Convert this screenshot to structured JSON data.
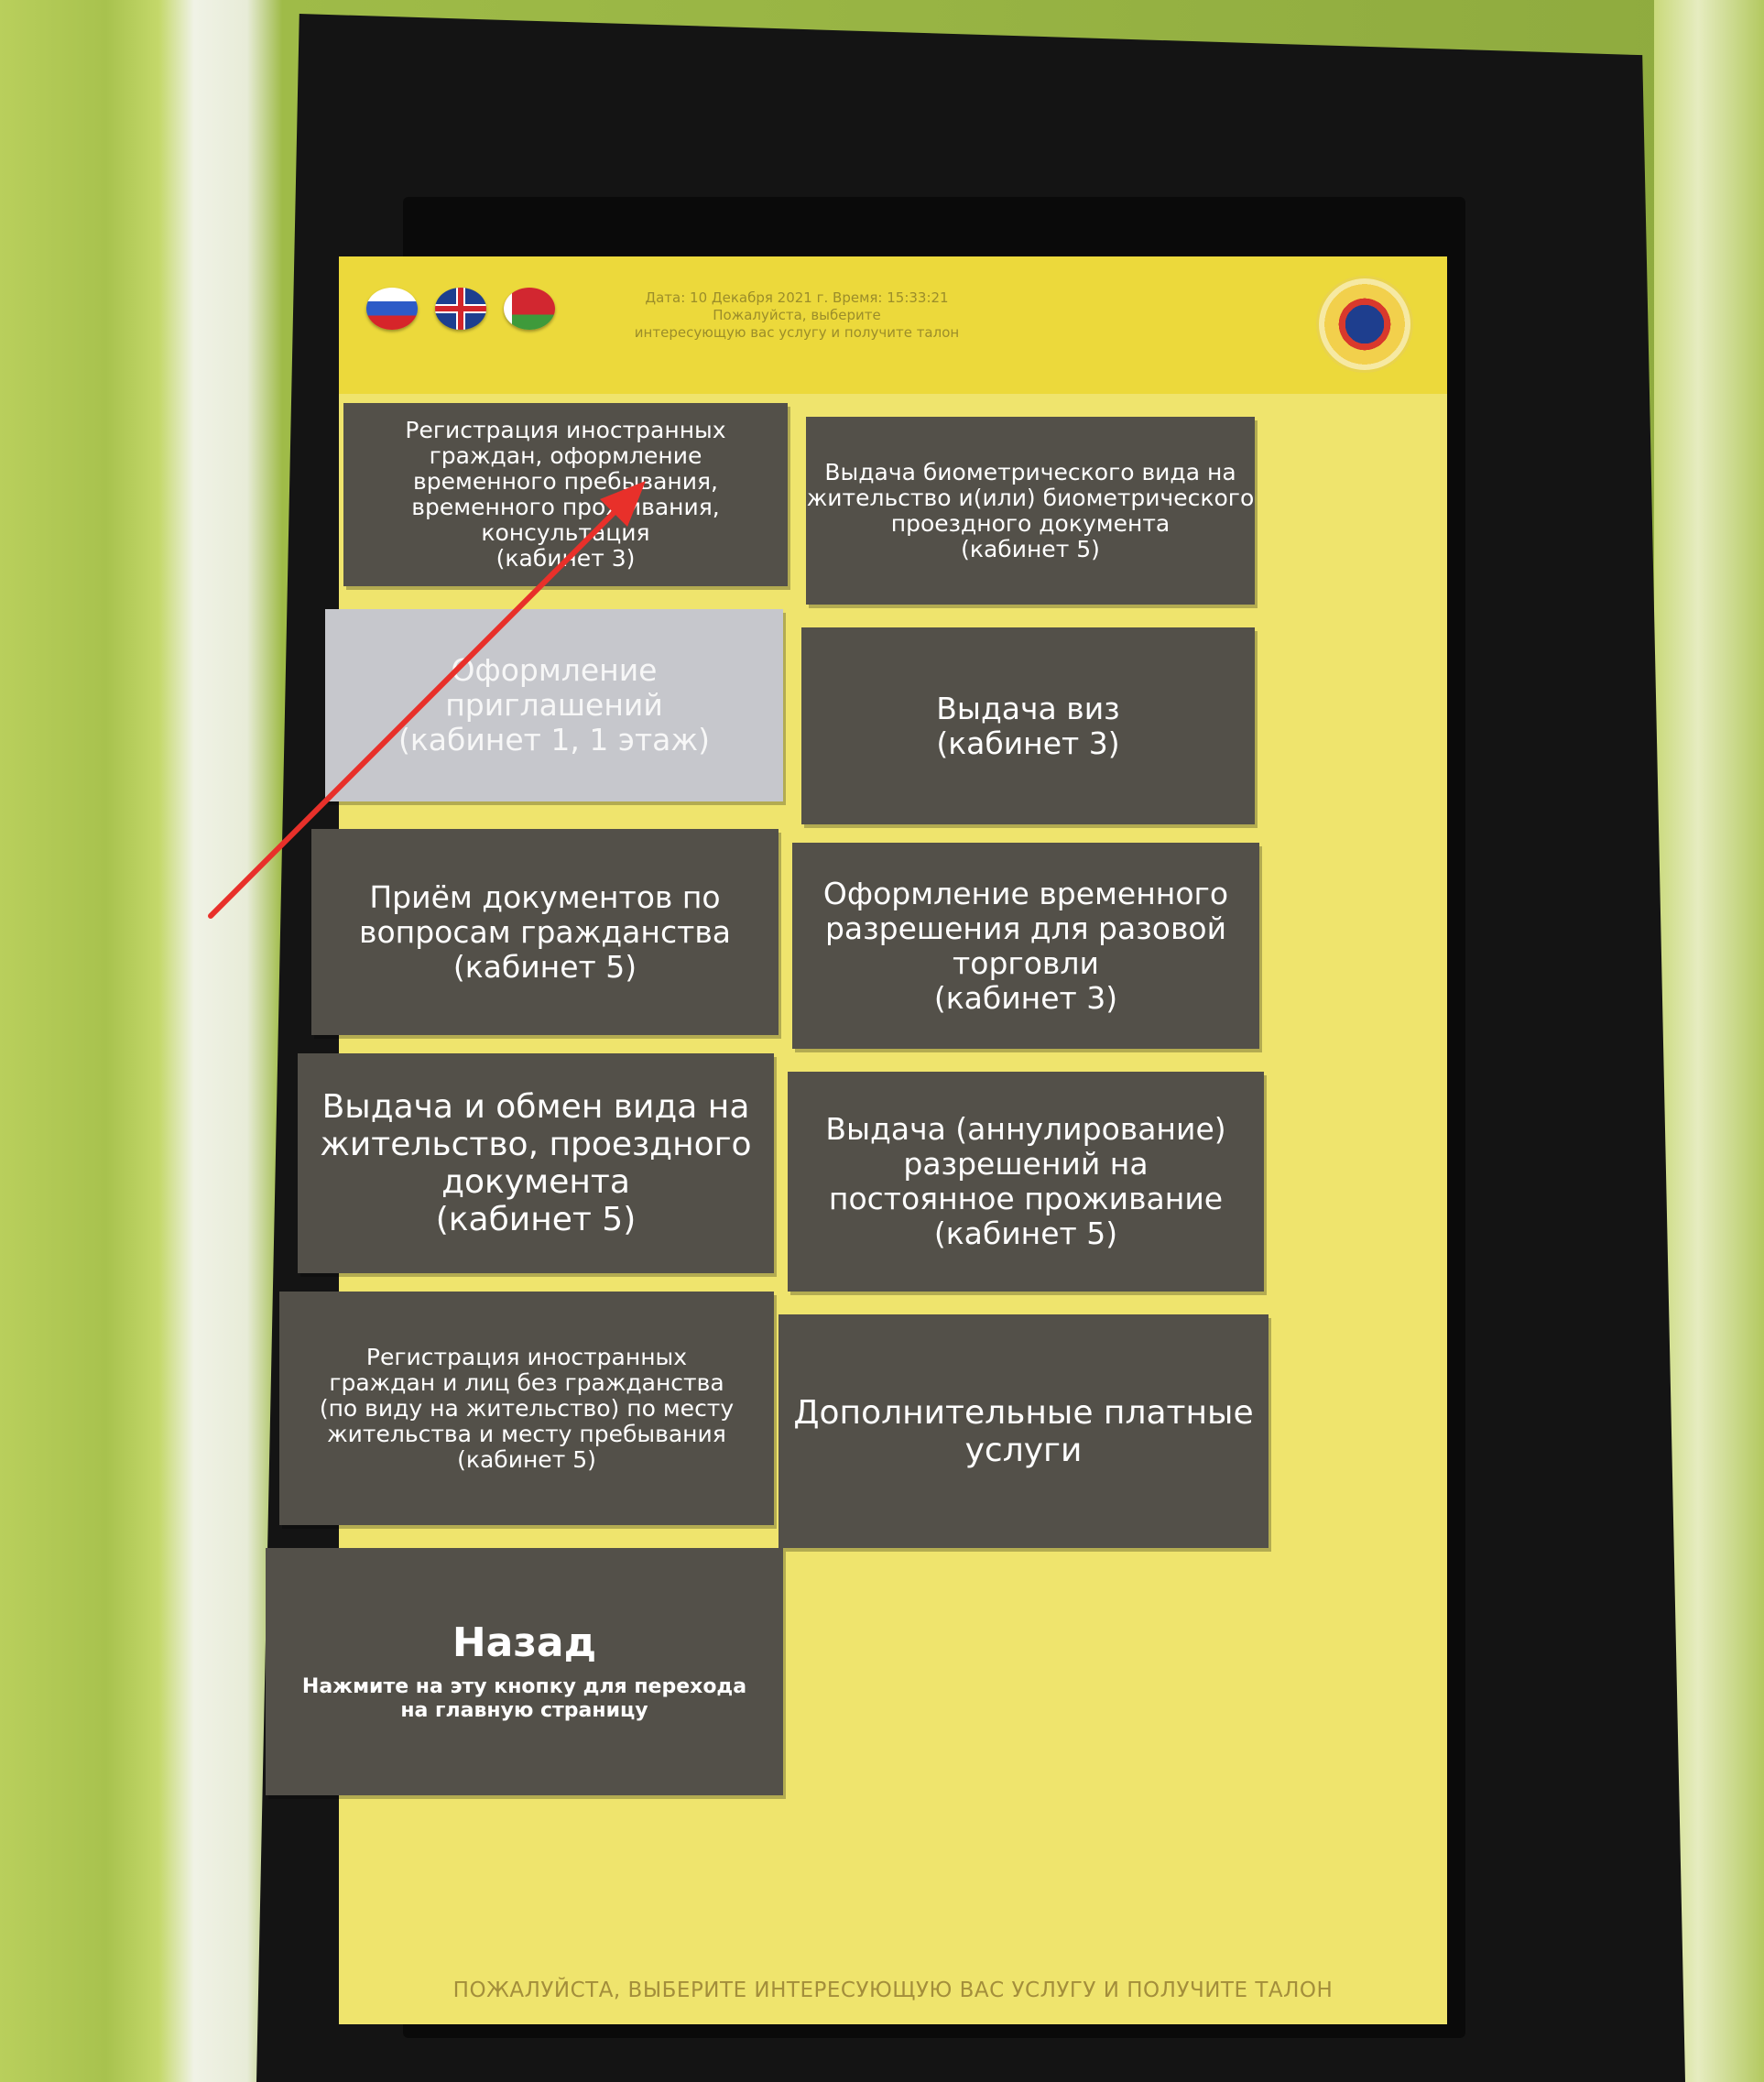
{
  "header": {
    "date_line": "Дата: 10 Декабря 2021 г.   Время: 15:33:21",
    "prompt_line1": "Пожалуйста, выберите",
    "prompt_line2": "интересующую вас услугу и получите талон"
  },
  "languages": [
    {
      "name": "ru-flag-icon"
    },
    {
      "name": "uk-flag-icon"
    },
    {
      "name": "by-flag-icon"
    }
  ],
  "buttons": {
    "b1": [
      "Регистрация иностранных",
      "граждан, оформление",
      "временного пребывания,",
      "временного проживания,",
      "консультация",
      "(кабинет 3)"
    ],
    "b2": [
      "Выдача биометрического вида на",
      "жительство и(или) биометрического",
      "проездного документа",
      "(кабинет 5)"
    ],
    "b3": [
      "Оформление",
      "приглашений",
      "(кабинет 1, 1 этаж)"
    ],
    "b4": [
      "Выдача виз",
      "(кабинет 3)"
    ],
    "b5": [
      "Приём документов по",
      "вопросам гражданства",
      "(кабинет 5)"
    ],
    "b6": [
      "Оформление временного",
      "разрешения для разовой",
      "торговли",
      "(кабинет 3)"
    ],
    "b7": [
      "Выдача и обмен вида на",
      "жительство, проездного",
      "документа",
      "(кабинет 5)"
    ],
    "b8": [
      "Выдача (аннулирование)",
      "разрешений на",
      "постоянное проживание",
      "(кабинет 5)"
    ],
    "b9": [
      "Регистрация иностранных",
      "граждан и лиц без гражданства",
      "(по виду на жительство) по месту",
      "жительства и месту пребывания",
      "(кабинет 5)"
    ],
    "b10": [
      "Дополнительные платные",
      "услуги"
    ],
    "back_title": "Назад",
    "back_sub1": "Нажмите на эту кнопку для перехода",
    "back_sub2": "на главную страницу"
  },
  "footer": "ПОЖАЛУЙСТА, ВЫБЕРИТЕ ИНТЕРЕСУЮЩУЮ ВАС УСЛУГУ И ПОЛУЧИТЕ ТАЛОН",
  "colors": {
    "screen_bg": "#efe46d",
    "button_bg": "#535049",
    "active_button_bg": "#c6c7cc",
    "annotation_arrow": "#e8302a"
  }
}
